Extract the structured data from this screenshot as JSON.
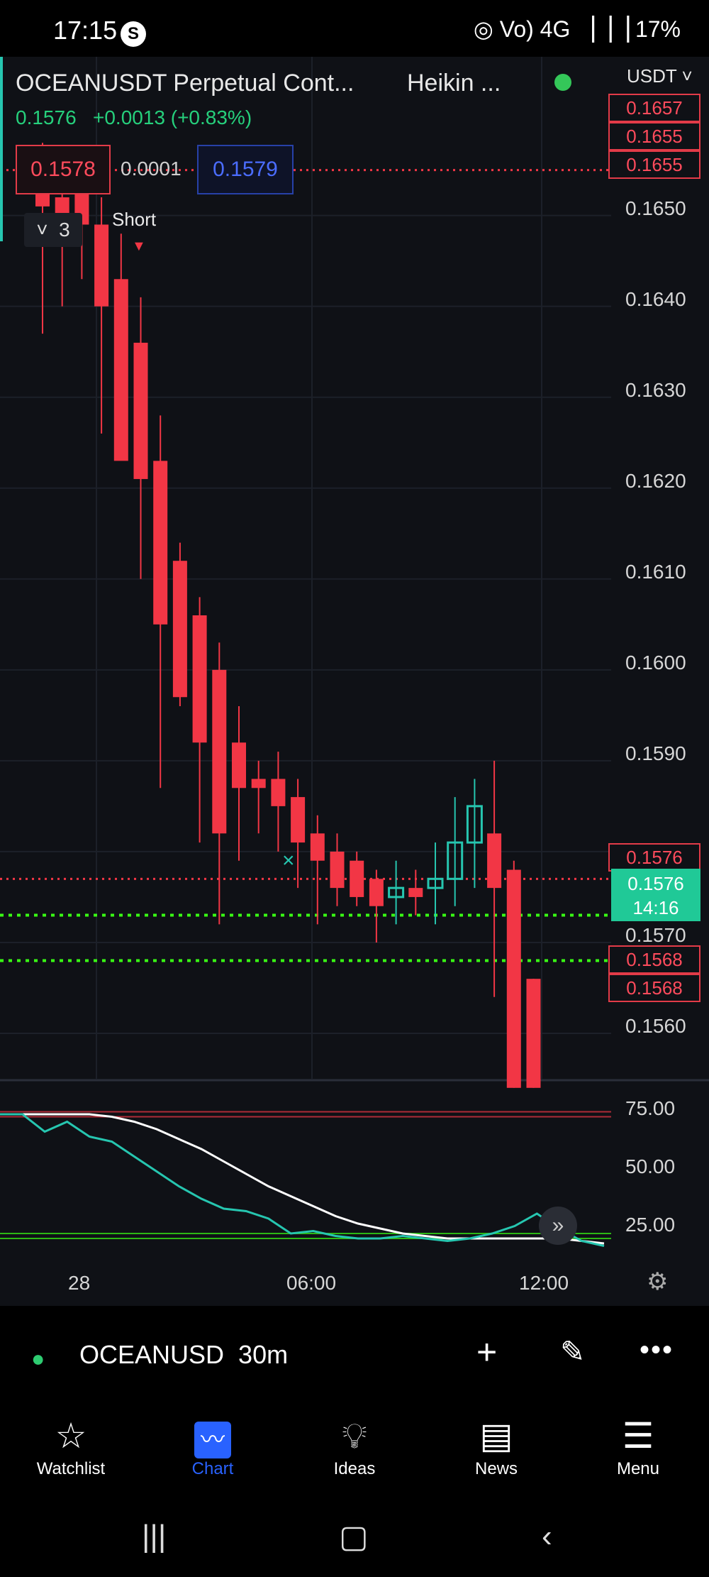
{
  "status_bar": {
    "time": "17:15",
    "app_icon": "S",
    "right": "◎ Vo) 4G ▕▕▕ 17%"
  },
  "header": {
    "title": "OCEANUSDT Perpetual Cont...",
    "chart_type": "Heikin ...",
    "currency": "USDT",
    "price": "0.1576",
    "change": "+0.0013 (+0.83%)"
  },
  "trade_panel": {
    "sell_price": "0.1578",
    "spread": "0.0001",
    "buy_price": "0.1579"
  },
  "collapse_count": "3",
  "order_label": "Short",
  "price_tags": {
    "top": [
      "0.1657",
      "0.1655",
      "0.1655"
    ],
    "mid": "0.1576",
    "low": [
      "0.1568",
      "0.1568"
    ]
  },
  "current_price": {
    "value": "0.1576",
    "countdown": "14:16"
  },
  "price_axis": [
    "0.1650",
    "0.1640",
    "0.1630",
    "0.1620",
    "0.1610",
    "0.1600",
    "0.1590",
    "0.1570",
    "0.1560"
  ],
  "indicator_axis": [
    "75.00",
    "50.00",
    "25.00"
  ],
  "time_axis": [
    "28",
    "06:00",
    "12:00"
  ],
  "toolbar": {
    "symbol": "OCEANUSD",
    "interval": "30m"
  },
  "nav": {
    "watchlist": "Watchlist",
    "chart": "Chart",
    "ideas": "Ideas",
    "news": "News",
    "menu": "Menu"
  },
  "colors": {
    "bull": "#26c6b0",
    "bear": "#f23645",
    "accent": "#2962ff"
  },
  "chart_data": {
    "type": "candlestick",
    "style": "Heikin Ashi",
    "ylim": [
      0.1555,
      0.1662
    ],
    "candles": [
      {
        "o": 0.1655,
        "h": 0.1658,
        "l": 0.1637,
        "c": 0.1651
      },
      {
        "o": 0.1652,
        "h": 0.1655,
        "l": 0.164,
        "c": 0.1648
      },
      {
        "o": 0.1655,
        "h": 0.1657,
        "l": 0.1643,
        "c": 0.1649
      },
      {
        "o": 0.1649,
        "h": 0.1652,
        "l": 0.1626,
        "c": 0.164
      },
      {
        "o": 0.1643,
        "h": 0.1648,
        "l": 0.1626,
        "c": 0.1623
      },
      {
        "o": 0.1636,
        "h": 0.1641,
        "l": 0.161,
        "c": 0.1621
      },
      {
        "o": 0.1623,
        "h": 0.1628,
        "l": 0.1587,
        "c": 0.1605
      },
      {
        "o": 0.1612,
        "h": 0.1614,
        "l": 0.1596,
        "c": 0.1597
      },
      {
        "o": 0.1606,
        "h": 0.1608,
        "l": 0.1581,
        "c": 0.1592
      },
      {
        "o": 0.16,
        "h": 0.1603,
        "l": 0.1572,
        "c": 0.1582
      },
      {
        "o": 0.1592,
        "h": 0.1596,
        "l": 0.1579,
        "c": 0.1587
      },
      {
        "o": 0.1588,
        "h": 0.159,
        "l": 0.1582,
        "c": 0.1587
      },
      {
        "o": 0.1588,
        "h": 0.1591,
        "l": 0.158,
        "c": 0.1585
      },
      {
        "o": 0.1586,
        "h": 0.1588,
        "l": 0.1576,
        "c": 0.1581
      },
      {
        "o": 0.1582,
        "h": 0.1584,
        "l": 0.1572,
        "c": 0.1579
      },
      {
        "o": 0.158,
        "h": 0.1582,
        "l": 0.1574,
        "c": 0.1576
      },
      {
        "o": 0.1579,
        "h": 0.158,
        "l": 0.1574,
        "c": 0.1575
      },
      {
        "o": 0.1577,
        "h": 0.1578,
        "l": 0.157,
        "c": 0.1574
      },
      {
        "o": 0.1575,
        "h": 0.1579,
        "l": 0.1572,
        "c": 0.1576
      },
      {
        "o": 0.1576,
        "h": 0.1578,
        "l": 0.1573,
        "c": 0.1575
      },
      {
        "o": 0.1576,
        "h": 0.1581,
        "l": 0.1572,
        "c": 0.1577
      },
      {
        "o": 0.1577,
        "h": 0.1586,
        "l": 0.1574,
        "c": 0.1581
      },
      {
        "o": 0.1581,
        "h": 0.1588,
        "l": 0.1576,
        "c": 0.1585
      },
      {
        "o": 0.1582,
        "h": 0.159,
        "l": 0.1564,
        "c": 0.1576
      },
      {
        "o": 0.1578,
        "h": 0.1579,
        "l": 0.1554,
        "c": 0.1554
      },
      {
        "o": 0.1566,
        "h": 0.1566,
        "l": 0.1554,
        "c": 0.1554
      }
    ],
    "lines": [
      {
        "price": 0.1655,
        "color": "#f23645",
        "style": "dotted"
      },
      {
        "price": 0.1577,
        "color": "#f23645",
        "style": "dotted"
      },
      {
        "price": 0.1573,
        "color": "#39ff14",
        "style": "dotted"
      },
      {
        "price": 0.1568,
        "color": "#39ff14",
        "style": "dotted"
      }
    ],
    "indicator": {
      "ylim": [
        15,
        85
      ],
      "level_lines": [
        76,
        74,
        27,
        25
      ],
      "fast": [
        75,
        75,
        68,
        72,
        66,
        64,
        58,
        52,
        46,
        41,
        37,
        36,
        33,
        27,
        28,
        26,
        25,
        25,
        26,
        25,
        24,
        25,
        27,
        30,
        35,
        29,
        24,
        22
      ],
      "slow": [
        75,
        75,
        75,
        75,
        75,
        74,
        72,
        69,
        65,
        61,
        56,
        51,
        46,
        42,
        38,
        34,
        31,
        29,
        27,
        26,
        25,
        25,
        25,
        25,
        25,
        25,
        24,
        23
      ]
    }
  }
}
